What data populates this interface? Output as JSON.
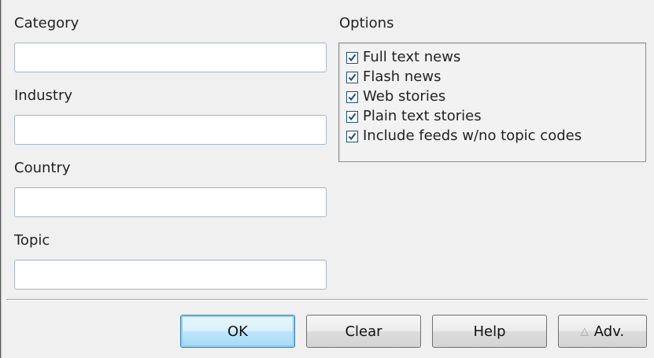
{
  "fields": {
    "category": {
      "label": "Category",
      "value": ""
    },
    "industry": {
      "label": "Industry",
      "value": ""
    },
    "country": {
      "label": "Country",
      "value": ""
    },
    "topic": {
      "label": "Topic",
      "value": ""
    }
  },
  "options": {
    "label": "Options",
    "items": [
      {
        "label": "Full text news",
        "checked": true
      },
      {
        "label": "Flash news",
        "checked": true
      },
      {
        "label": "Web stories",
        "checked": true
      },
      {
        "label": "Plain text stories",
        "checked": true
      },
      {
        "label": "Include feeds w/no topic codes",
        "checked": true
      }
    ]
  },
  "buttons": {
    "ok": "OK",
    "clear": "Clear",
    "help": "Help",
    "adv": "Adv.",
    "adv_icon": "triangle-up-icon"
  },
  "colors": {
    "checkmark": "#1c4f8c",
    "default_button_border": "#3c7fb1"
  }
}
